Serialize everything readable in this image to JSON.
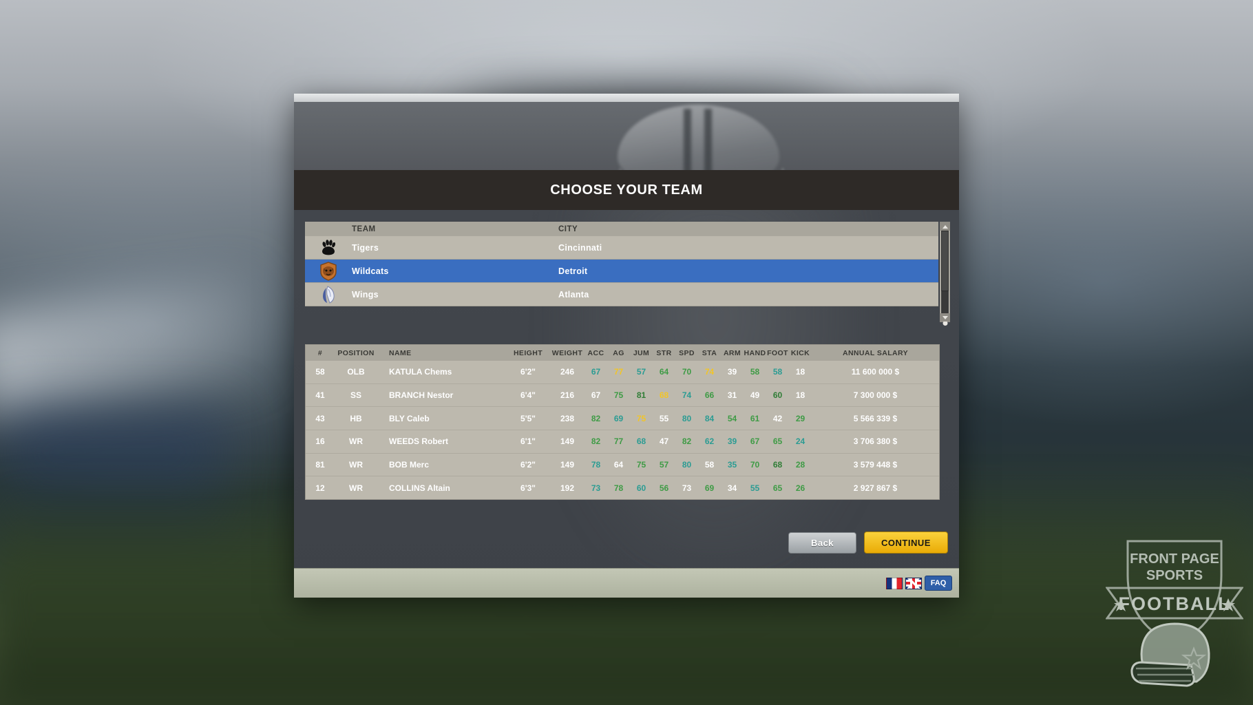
{
  "window": {
    "title": "CHOOSE YOUR TEAM"
  },
  "team_table": {
    "headers": {
      "logo": "",
      "team": "TEAM",
      "city": "CITY"
    },
    "rows": [
      {
        "logo": "paw-print-icon",
        "team": "Tigers",
        "city": "Cincinnati",
        "selected": false
      },
      {
        "logo": "wildcat-shield-icon",
        "team": "Wildcats",
        "city": "Detroit",
        "selected": true
      },
      {
        "logo": "wing-icon",
        "team": "Wings",
        "city": "Atlanta",
        "selected": false
      }
    ],
    "scrollbar": {
      "up_arrow": "chevron-up-icon",
      "down_arrow": "chevron-down-icon"
    }
  },
  "roster_table": {
    "headers": [
      "#",
      "POSITION",
      "NAME",
      "HEIGHT",
      "WEIGHT",
      "ACC",
      "AG",
      "JUM",
      "STR",
      "SPD",
      "STA",
      "ARM",
      "HAND",
      "FOOT",
      "KICK",
      "ANNUAL SALARY"
    ],
    "rows": [
      {
        "number": "58",
        "position": "OLB",
        "name": "KATULA Chems",
        "height": "6'2\"",
        "weight": "246",
        "stats": [
          {
            "v": "67",
            "c": "teal"
          },
          {
            "v": "77",
            "c": "gold"
          },
          {
            "v": "57",
            "c": "teal"
          },
          {
            "v": "64",
            "c": "green"
          },
          {
            "v": "70",
            "c": "green"
          },
          {
            "v": "74",
            "c": "gold"
          },
          {
            "v": "39",
            "c": "white"
          },
          {
            "v": "58",
            "c": "green"
          },
          {
            "v": "58",
            "c": "teal"
          },
          {
            "v": "18",
            "c": "white"
          }
        ],
        "salary": "11 600 000 $"
      },
      {
        "number": "41",
        "position": "SS",
        "name": "BRANCH Nestor",
        "height": "6'4\"",
        "weight": "216",
        "stats": [
          {
            "v": "67",
            "c": "white"
          },
          {
            "v": "75",
            "c": "green"
          },
          {
            "v": "81",
            "c": "dgreen"
          },
          {
            "v": "68",
            "c": "gold"
          },
          {
            "v": "74",
            "c": "teal"
          },
          {
            "v": "66",
            "c": "green"
          },
          {
            "v": "31",
            "c": "white"
          },
          {
            "v": "49",
            "c": "white"
          },
          {
            "v": "60",
            "c": "dgreen"
          },
          {
            "v": "18",
            "c": "white"
          }
        ],
        "salary": "7 300 000 $"
      },
      {
        "number": "43",
        "position": "HB",
        "name": "BLY Caleb",
        "height": "5'5\"",
        "weight": "238",
        "stats": [
          {
            "v": "82",
            "c": "green"
          },
          {
            "v": "69",
            "c": "teal"
          },
          {
            "v": "75",
            "c": "gold"
          },
          {
            "v": "55",
            "c": "white"
          },
          {
            "v": "80",
            "c": "teal"
          },
          {
            "v": "84",
            "c": "teal"
          },
          {
            "v": "54",
            "c": "green"
          },
          {
            "v": "61",
            "c": "green"
          },
          {
            "v": "42",
            "c": "white"
          },
          {
            "v": "29",
            "c": "green"
          }
        ],
        "salary": "5 566 339 $"
      },
      {
        "number": "16",
        "position": "WR",
        "name": "WEEDS Robert",
        "height": "6'1\"",
        "weight": "149",
        "stats": [
          {
            "v": "82",
            "c": "green"
          },
          {
            "v": "77",
            "c": "green"
          },
          {
            "v": "68",
            "c": "teal"
          },
          {
            "v": "47",
            "c": "white"
          },
          {
            "v": "82",
            "c": "green"
          },
          {
            "v": "62",
            "c": "teal"
          },
          {
            "v": "39",
            "c": "teal"
          },
          {
            "v": "67",
            "c": "green"
          },
          {
            "v": "65",
            "c": "green"
          },
          {
            "v": "24",
            "c": "teal"
          }
        ],
        "salary": "3 706 380 $"
      },
      {
        "number": "81",
        "position": "WR",
        "name": "BOB Merc",
        "height": "6'2\"",
        "weight": "149",
        "stats": [
          {
            "v": "78",
            "c": "teal"
          },
          {
            "v": "64",
            "c": "white"
          },
          {
            "v": "75",
            "c": "green"
          },
          {
            "v": "57",
            "c": "green"
          },
          {
            "v": "80",
            "c": "teal"
          },
          {
            "v": "58",
            "c": "white"
          },
          {
            "v": "35",
            "c": "teal"
          },
          {
            "v": "70",
            "c": "green"
          },
          {
            "v": "68",
            "c": "dgreen"
          },
          {
            "v": "28",
            "c": "green"
          }
        ],
        "salary": "3 579 448 $"
      },
      {
        "number": "12",
        "position": "WR",
        "name": "COLLINS Altain",
        "height": "6'3\"",
        "weight": "192",
        "stats": [
          {
            "v": "73",
            "c": "teal"
          },
          {
            "v": "78",
            "c": "green"
          },
          {
            "v": "60",
            "c": "teal"
          },
          {
            "v": "56",
            "c": "green"
          },
          {
            "v": "73",
            "c": "white"
          },
          {
            "v": "69",
            "c": "green"
          },
          {
            "v": "34",
            "c": "white"
          },
          {
            "v": "55",
            "c": "teal"
          },
          {
            "v": "65",
            "c": "green"
          },
          {
            "v": "26",
            "c": "green"
          }
        ],
        "salary": "2 927 867 $"
      }
    ]
  },
  "footer": {
    "back_label": "Back",
    "continue_label": "CONTINUE"
  },
  "status_bar": {
    "flag_fr": "france-flag-icon",
    "flag_uk": "uk-flag-icon",
    "faq_label": "FAQ"
  },
  "corner_logo": {
    "line1": "FRONT PAGE",
    "line2": "SPORTS",
    "line3": "FOOTBALL"
  },
  "colors": {
    "accent_blue": "#3a6ec0",
    "accent_yellow": "#f2c527",
    "title_bar": "#2e2a27",
    "table_row": "#bdb9ae",
    "table_header": "#a9a69c",
    "stat_teal": "#2b9c93",
    "stat_green": "#3e9b45",
    "stat_dgreen": "#2f7d36",
    "stat_gold": "#f2c527",
    "stat_white": "#ffffff"
  }
}
